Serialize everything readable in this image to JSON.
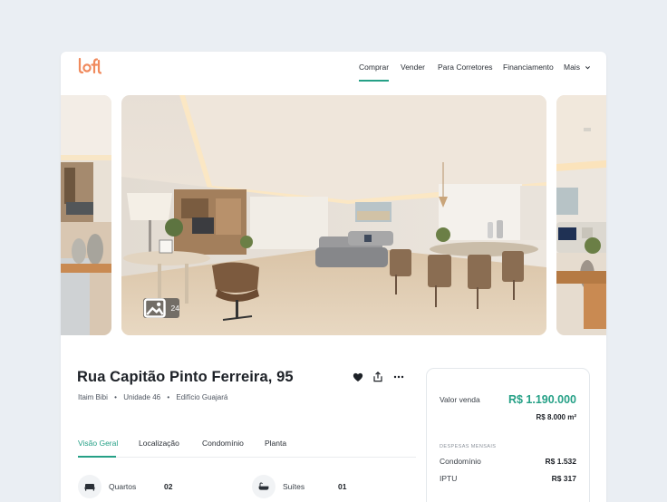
{
  "brand": {
    "logo_text": "loft",
    "accent_color": "#f08a5d",
    "primary_color": "#25a086"
  },
  "nav": {
    "items": [
      {
        "label": "Comprar",
        "active": true
      },
      {
        "label": "Vender"
      },
      {
        "label": "Para Corretores"
      },
      {
        "label": "Financiamento"
      },
      {
        "label": "Mais",
        "icon": "chevron-down-icon"
      }
    ]
  },
  "gallery": {
    "photo_count": "24",
    "icon": "image-icon"
  },
  "listing": {
    "title": "Rua Capitão Pinto Ferreira, 95",
    "neighborhood": "Itaim Bibi",
    "unit": "Unidade 46",
    "building": "Edifício Guajará",
    "separator": "•"
  },
  "actions": [
    {
      "name": "favorite",
      "icon": "heart-icon"
    },
    {
      "name": "share",
      "icon": "share-icon"
    },
    {
      "name": "more",
      "icon": "more-icon"
    }
  ],
  "tabs": [
    {
      "label": "Visão Geral",
      "active": true
    },
    {
      "label": "Localização"
    },
    {
      "label": "Condomínio"
    },
    {
      "label": "Planta"
    }
  ],
  "features": [
    {
      "label": "Quartos",
      "value": "02",
      "icon": "bed-icon"
    },
    {
      "label": "Suítes",
      "value": "01",
      "icon": "bathtub-icon"
    }
  ],
  "price_card": {
    "sale_label": "Valor venda",
    "sale_price": "R$ 1.190.000",
    "price_per_m2": "R$ 8.000 m²",
    "monthly_header": "DESPESAS MENSAIS",
    "condo_label": "Condomínio",
    "condo_value": "R$ 1.532",
    "iptu_label": "IPTU",
    "iptu_value": "R$ 317"
  }
}
